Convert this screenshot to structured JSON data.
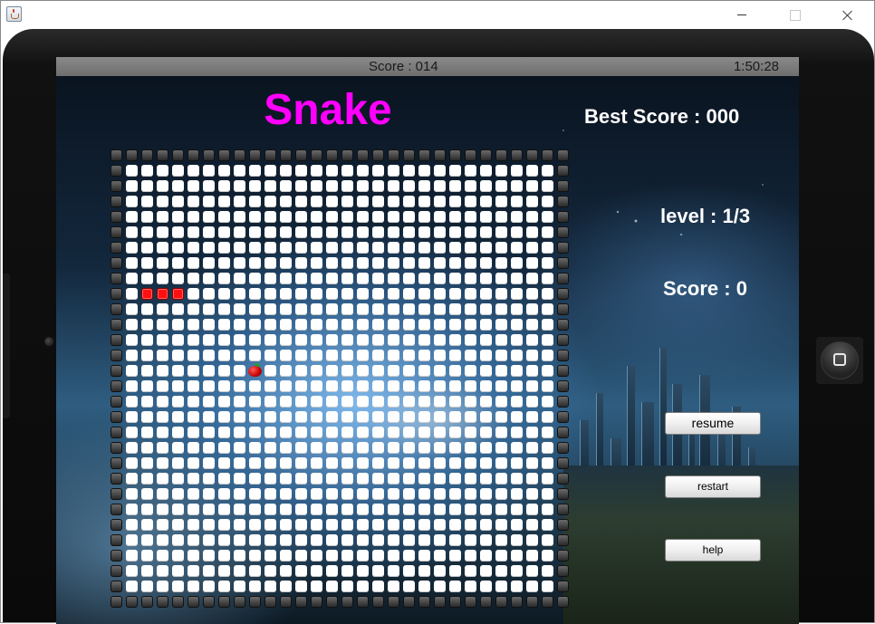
{
  "window": {
    "app_icon": "java-coffee-cup-icon",
    "controls": [
      "minimize-icon",
      "maximize-icon",
      "close-icon"
    ]
  },
  "status_bar": {
    "score": "Score : 014",
    "time": "1:50:28"
  },
  "game": {
    "title": "Snake",
    "best_score": "Best Score : 000",
    "level": "level : 1/3",
    "score": "Score : 0",
    "buttons": {
      "resume": "resume",
      "restart": "restart",
      "help": "help"
    },
    "board": {
      "columns": 30,
      "rows": 30,
      "snake": [
        [
          2,
          9
        ],
        [
          3,
          9
        ],
        [
          4,
          9
        ]
      ],
      "apple": [
        9,
        14
      ]
    },
    "colors": {
      "title": "#ff00ff",
      "snake": "#ff1010",
      "empty_cell": "#ffffff",
      "wall_cell": "#3a3a3a"
    }
  },
  "device": {
    "home_button_icon": "home-square-icon"
  }
}
